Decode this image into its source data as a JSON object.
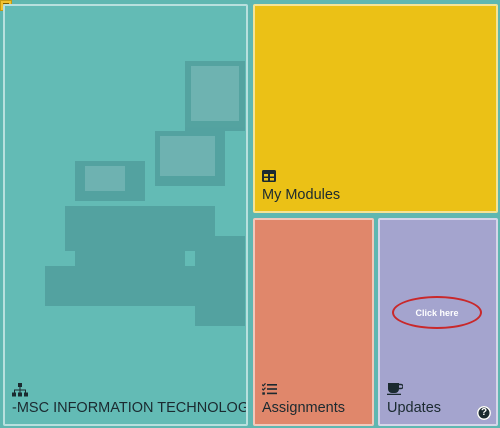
{
  "menu": {
    "icon": "hamburger-icon"
  },
  "tiles": {
    "course": {
      "label": "-MSC INFORMATION TECHNOLOGY",
      "icon": "sitemap-icon",
      "color": "#63bbb5"
    },
    "modules": {
      "label": "My Modules",
      "icon": "table-icon",
      "color": "#ebc116"
    },
    "assignments": {
      "label": "Assignments",
      "icon": "tasks-checklist-icon",
      "color": "#e0876b"
    },
    "updates": {
      "label": "Updates",
      "icon": "coffee-cup-icon",
      "color": "#a4a4ce",
      "click_label": "Click here",
      "help_symbol": "?"
    }
  },
  "colors": {
    "page_background": "#5fb7b1",
    "annotation_oval": "#c9282a"
  }
}
